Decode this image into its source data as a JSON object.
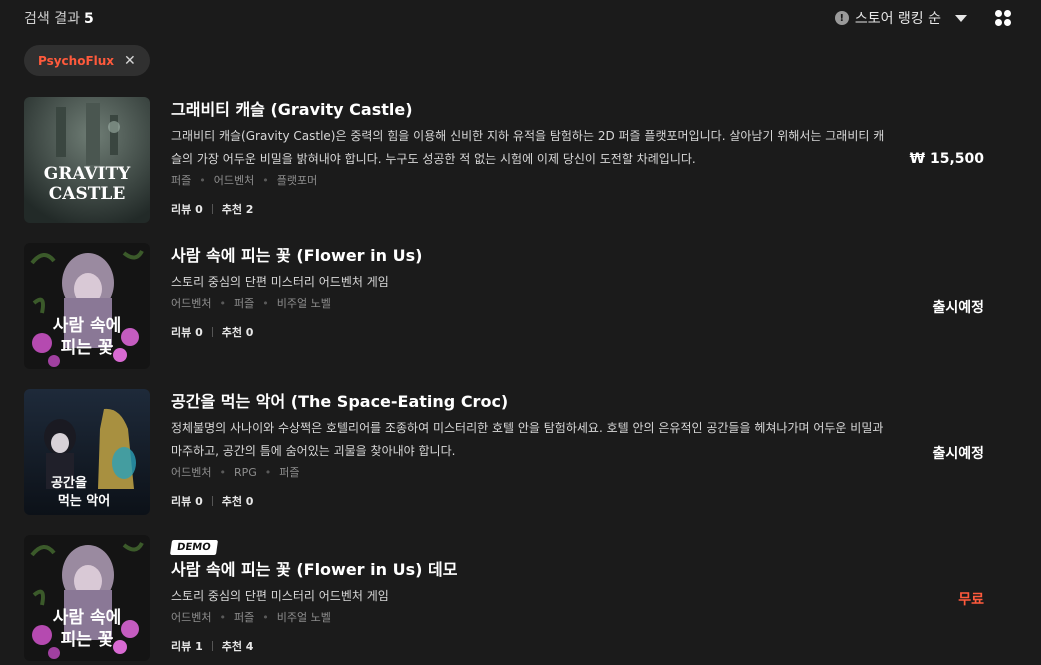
{
  "header": {
    "result_label": "검색 결과",
    "result_count": "5",
    "sort_label": "스토어 랭킹 순"
  },
  "filter_chip": {
    "label": "PsychoFlux"
  },
  "items": [
    {
      "thumb_text_1": "GRAVITY",
      "thumb_text_2": "CASTLE",
      "title": "그래비티 캐슬 (Gravity Castle)",
      "desc": "그래비티 캐슬(Gravity Castle)은 중력의 힘을 이용해 신비한 지하 유적을 탐험하는 2D 퍼즐 플랫포머입니다. 살아남기 위해서는 그래비티 캐슬의 가장 어두운 비밀을 밝혀내야 합니다. 누구도 성공한 적 없는 시험에 이제 당신이 도전할 차례입니다.",
      "tags": [
        "퍼즐",
        "어드벤처",
        "플랫포머"
      ],
      "reviews": "리뷰 0",
      "recommends": "추천 2",
      "price": "₩ 15,500"
    },
    {
      "thumb_text_1": "사람 속에",
      "thumb_text_2": "피는 꽃",
      "title": "사람 속에 피는 꽃 (Flower in Us)",
      "desc": "스토리 중심의 단편 미스터리 어드벤처 게임",
      "tags": [
        "어드벤처",
        "퍼즐",
        "비주얼 노벨"
      ],
      "reviews": "리뷰 0",
      "recommends": "추천 0",
      "price": "출시예정"
    },
    {
      "thumb_text_1": "공간을",
      "thumb_text_2": "먹는 악어",
      "title": "공간을 먹는 악어 (The Space-Eating Croc)",
      "desc": "정체불명의 사나이와 수상쩍은 호텔리어를 조종하여 미스터리한 호텔 안을 탐험하세요. 호텔 안의 은유적인 공간들을 헤쳐나가며 어두운 비밀과 마주하고, 공간의 틈에 숨어있는 괴물을 찾아내야 합니다.",
      "tags": [
        "어드벤처",
        "RPG",
        "퍼즐"
      ],
      "reviews": "리뷰 0",
      "recommends": "추천 0",
      "price": "출시예정"
    },
    {
      "badge": "DEMO",
      "thumb_text_1": "사람 속에",
      "thumb_text_2": "피는 꽃",
      "title": "사람 속에 피는 꽃 (Flower in Us) 데모",
      "desc": "스토리 중심의 단편 미스터리 어드벤처 게임",
      "tags": [
        "어드벤처",
        "퍼즐",
        "비주얼 노벨"
      ],
      "reviews": "리뷰 1",
      "recommends": "추천 4",
      "price": "무료"
    }
  ],
  "colors": {
    "background": "#1b1b1b",
    "accent": "#ff5a3c",
    "chip_bg": "#303030"
  }
}
